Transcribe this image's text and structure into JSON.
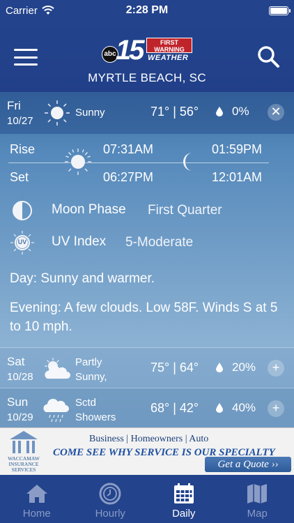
{
  "status": {
    "carrier": "Carrier",
    "time": "2:28 PM"
  },
  "header": {
    "logo_network": "abc",
    "logo_channel": "15",
    "logo_badge": "FIRST WARNING",
    "logo_weather": "WEATHER",
    "location": "MYRTLE BEACH, SC"
  },
  "today": {
    "day": "Fri",
    "date": "10/27",
    "condition": "Sunny",
    "temps": "71° | 56°",
    "precip": "0%",
    "toggle": "✕",
    "icon": "sun-icon"
  },
  "sun_moon": {
    "rise_label": "Rise",
    "set_label": "Set",
    "sunrise": "07:31AM",
    "sunset": "06:27PM",
    "moonrise": "01:59PM",
    "moonset": "12:01AM"
  },
  "moon_phase": {
    "label": "Moon Phase",
    "value": "First Quarter",
    "icon": "moon-phase-icon"
  },
  "uv_index": {
    "label": "UV Index",
    "value": "5-Moderate",
    "icon_text": "UV"
  },
  "forecast": {
    "day": "Day: Sunny and warmer.",
    "evening": "Evening: A few clouds. Low 58F. Winds S at 5 to 10 mph."
  },
  "days": [
    {
      "day": "Sat",
      "date": "10/28",
      "condition_line1": "Partly",
      "condition_line2": "Sunny,",
      "temps": "75° | 64°",
      "precip": "20%",
      "toggle": "+",
      "icon": "partly-sunny-icon"
    },
    {
      "day": "Sun",
      "date": "10/29",
      "condition_line1": "Sctd",
      "condition_line2": "Showers",
      "temps": "68° | 42°",
      "precip": "40%",
      "toggle": "+",
      "icon": "showers-icon"
    }
  ],
  "ad": {
    "logo_name": "WACCAMAW INSURANCE SERVICES",
    "line1": "Business | Homeowners | Auto",
    "line2": "COME SEE WHY SERVICE IS OUR SPECIALTY",
    "cta": "Get a Quote ››"
  },
  "tabs": [
    {
      "label": "Home",
      "icon": "home-icon"
    },
    {
      "label": "Hourly",
      "icon": "clock-icon"
    },
    {
      "label": "Daily",
      "icon": "calendar-icon",
      "active": true
    },
    {
      "label": "Map",
      "icon": "map-icon"
    }
  ],
  "colors": {
    "header_bg": "#23438c",
    "tab_inactive": "#8a9cc6",
    "ad_blue": "#1d4fa0",
    "badge_red": "#c0242b"
  }
}
